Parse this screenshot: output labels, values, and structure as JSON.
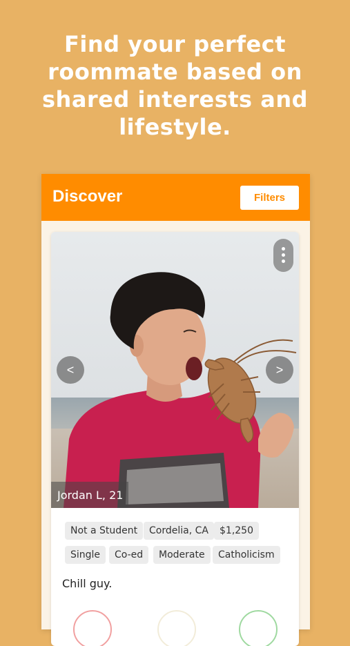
{
  "promo": {
    "headline_lines": [
      "Find your perfect",
      "roommate based on",
      "shared interests and",
      "lifestyle."
    ]
  },
  "app": {
    "title": "Discover",
    "filters_label": "Filters",
    "accent_color": "#ff8c00",
    "background_color": "#e8b264"
  },
  "profile": {
    "name_age": "Jordan L, 21",
    "prev_label": "<",
    "next_label": ">",
    "tags": [
      "Not a Student",
      "Cordelia, CA",
      "$1,250",
      "Single",
      "Co-ed",
      "Moderate",
      "Catholicism"
    ],
    "bio": "Chill guy."
  },
  "icons": {
    "more": "more-vertical-icon",
    "reject": "reject-action",
    "favorite": "favorite-action",
    "accept": "accept-action"
  }
}
